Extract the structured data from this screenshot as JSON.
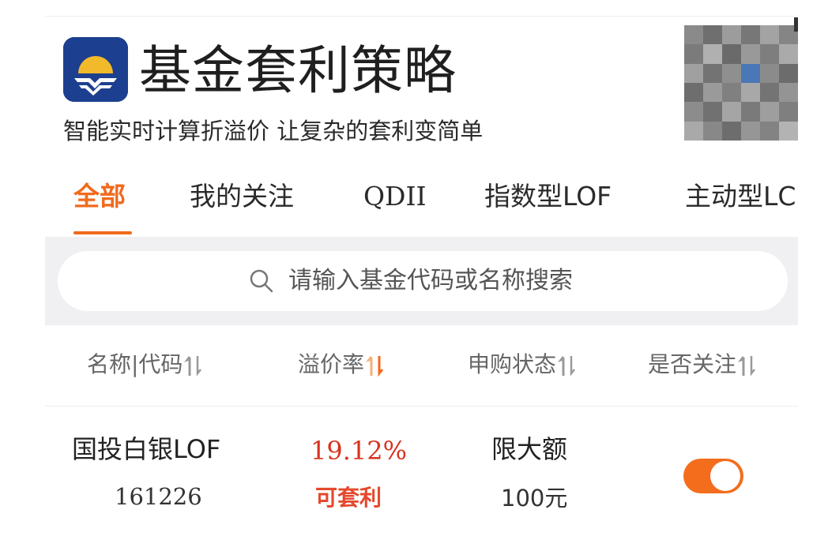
{
  "header": {
    "title": "基金套利策略",
    "subtitle": "智能实时计算折溢价 让复杂的套利变简单",
    "logo_icon": "fund-logo-icon",
    "qr_icon": "qr-code-icon"
  },
  "tabs": [
    {
      "label": "全部",
      "active": true
    },
    {
      "label": "我的关注",
      "active": false
    },
    {
      "label": "QDII",
      "active": false
    },
    {
      "label": "指数型LOF",
      "active": false
    },
    {
      "label": "主动型LC",
      "active": false
    }
  ],
  "search": {
    "placeholder": "请输入基金代码或名称搜索",
    "icon": "search-icon"
  },
  "sort_header": {
    "columns": [
      {
        "label": "名称|代码"
      },
      {
        "label": "溢价率",
        "highlighted": true
      },
      {
        "label": "申购状态"
      },
      {
        "label": "是否关注"
      }
    ]
  },
  "rows": [
    {
      "name": "国投白银LOF",
      "code": "161226",
      "premium": "19.12%",
      "arbitrage_tag": "可套利",
      "subscribe_status": "限大额",
      "subscribe_limit": "100元",
      "followed": true
    }
  ],
  "colors": {
    "accent": "#f06a1c",
    "premium_red": "#d8321f",
    "logo_blue": "#1d3f8f"
  }
}
